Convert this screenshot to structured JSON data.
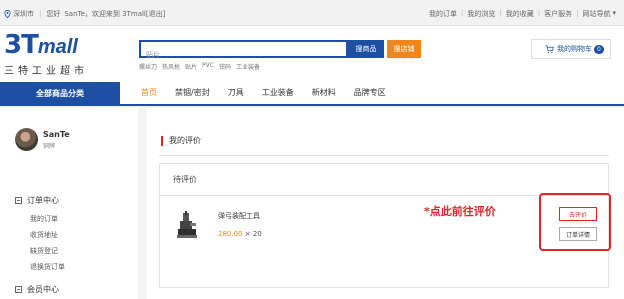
{
  "topbar": {
    "location": "深圳市",
    "greeting": "您好",
    "username": "SanTe",
    "welcome": "，欢迎来到 3Tmall",
    "logout": "[退出]",
    "links": [
      "我的订单",
      "我的浏览",
      "我的收藏",
      "客户服务",
      "网站导航"
    ]
  },
  "header": {
    "logo_brand": "3T",
    "logo_mall": "mall",
    "logo_sub": "三特工业超市",
    "search_placeholder": "贴片",
    "search_button": "搜商品",
    "store_button": "搜店铺",
    "hot_words": [
      "螺丝刀",
      "热风枪",
      "贴片",
      "PVC",
      "钳码",
      "工业装备"
    ],
    "cart_label": "我的购物车",
    "cart_count": "0"
  },
  "nav": {
    "all_categories": "全部商品分类",
    "items": [
      "首页",
      "禁锢/密封",
      "刀具",
      "工业装备",
      "新材料",
      "品牌专区"
    ]
  },
  "sidebar": {
    "user_name": "SanTe",
    "user_level": "铜牌",
    "sections": [
      {
        "title": "订单中心",
        "items": [
          "我的订单",
          "收货地址",
          "缺货登记",
          "退换货订单"
        ]
      },
      {
        "title": "会员中心"
      }
    ]
  },
  "main": {
    "title": "我的评价",
    "panel_title": "待评价",
    "product": {
      "name": "弹弓装配工具",
      "price": "280.00",
      "qty_text": "× 20"
    },
    "annotation": "*点此前往评价",
    "review_button": "去评价",
    "detail_button": "订单详情"
  },
  "colors": {
    "brand_blue": "#1d4fa3",
    "accent_orange": "#f08519",
    "annotation_red": "#e0262b"
  },
  "icons": [
    "location-pin-icon",
    "cart-icon",
    "minus-square-icon"
  ]
}
